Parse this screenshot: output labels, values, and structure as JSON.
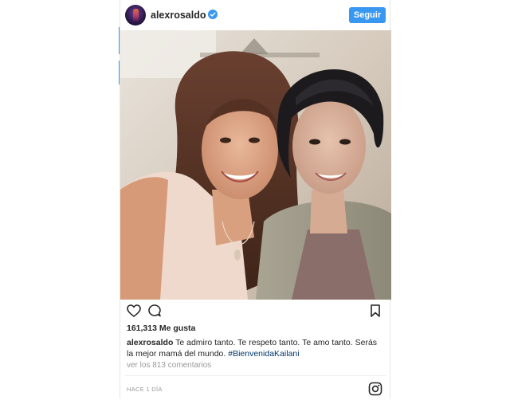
{
  "post": {
    "username": "alexrosaldo",
    "follow_label": "Seguir",
    "likes": "161,313 Me gusta",
    "caption_user": "alexrosaldo",
    "caption_text": " Te admiro tanto. Te respeto tanto. Te amo tanto. Serás la mejor mamá del mundo. ",
    "caption_hashtag": "#BienvenidaKailani",
    "comments_link": "ver los 813 comentarios",
    "timestamp": "HACE 1 DÍA"
  },
  "icons": {
    "avatar": "profile-avatar",
    "verified": "verified-badge-icon",
    "like": "heart-icon",
    "comment": "comment-bubble-icon",
    "save": "bookmark-icon",
    "brand": "instagram-icon"
  },
  "colors": {
    "accent": "#3897f0",
    "text": "#262626",
    "muted": "#999999",
    "hashtag": "#003569"
  }
}
